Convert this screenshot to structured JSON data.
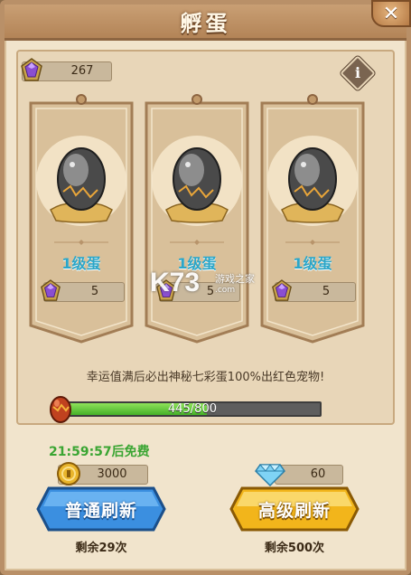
{
  "header": {
    "title": "孵蛋",
    "close_label": "✕"
  },
  "currency": {
    "gem_count": "267",
    "info_label": "i"
  },
  "cards": [
    {
      "level_label": "1级蛋",
      "cost": "5"
    },
    {
      "level_label": "1级蛋",
      "cost": "5"
    },
    {
      "level_label": "1级蛋",
      "cost": "5"
    }
  ],
  "luck": {
    "message": "幸运值满后必出神秘七彩蛋100%出红色宠物!",
    "progress_text": "445/800",
    "progress_fraction": 0.556
  },
  "refresh": {
    "timer_text": "21:59:57后免费",
    "normal": {
      "price": "3000",
      "label": "普通刷新",
      "remaining": "剩余29次"
    },
    "advanced": {
      "price": "60",
      "label": "高级刷新",
      "remaining": "剩余500次"
    }
  },
  "watermark": {
    "logo": "K73",
    "site_name": "游戏之家",
    "url": ".com"
  },
  "colors": {
    "accent_blue": "#2aa6c9",
    "progress_green": "#45b028",
    "timer_green": "#3aa532",
    "button_blue": "#3b8fe0",
    "button_gold": "#f2b51b"
  }
}
